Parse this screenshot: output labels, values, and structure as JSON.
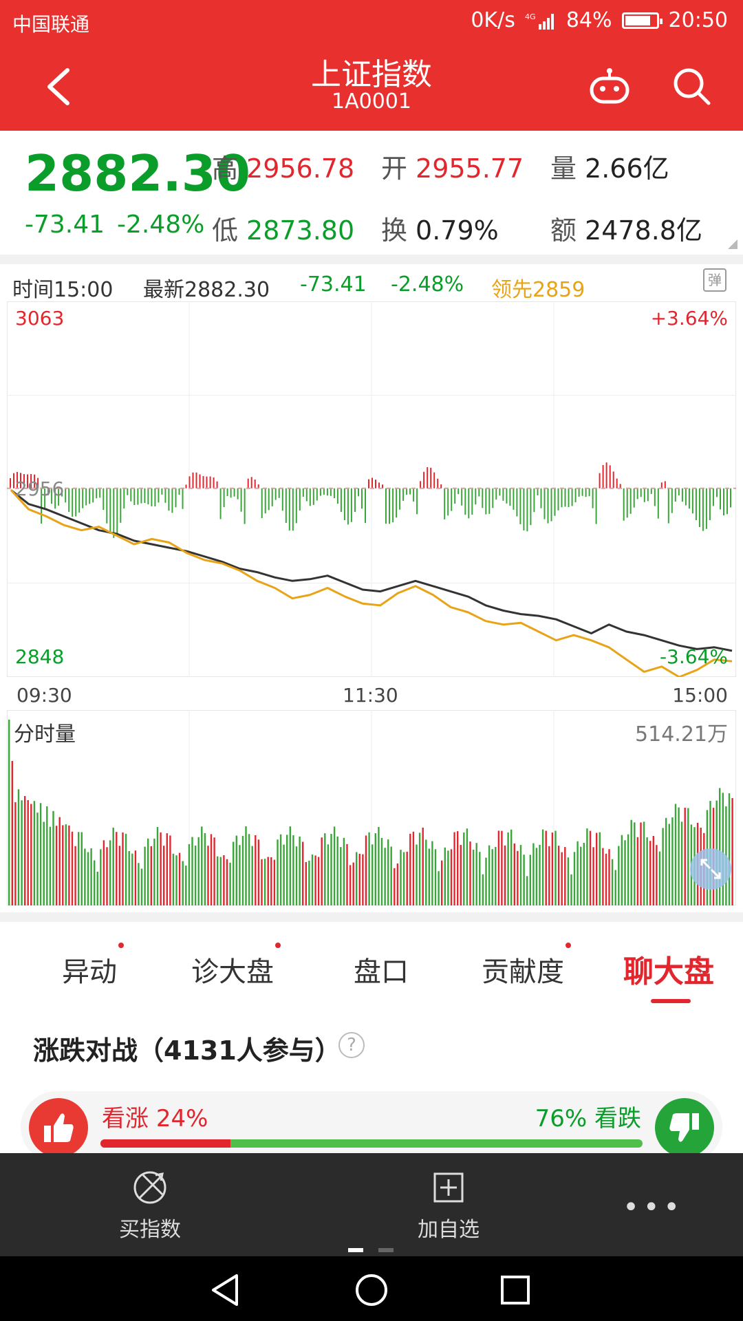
{
  "status": {
    "carrier": "中国联通",
    "speed": "0K/s",
    "battery": "84%",
    "battery_level": 0.84,
    "time": "20:50"
  },
  "header": {
    "title": "上证指数",
    "code": "1A0001"
  },
  "quote": {
    "price": "2882.30",
    "change": "-73.41",
    "change_pct": "-2.48%",
    "high_label": "高",
    "high": "2956.78",
    "open_label": "开",
    "open": "2955.77",
    "volume_label": "量",
    "volume": "2.66亿",
    "low_label": "低",
    "low": "2873.80",
    "turnover_label": "换",
    "turnover": "0.79%",
    "amount_label": "额",
    "amount": "2478.8亿"
  },
  "info": {
    "time": "时间15:00",
    "latest": "最新2882.30",
    "change": "-73.41",
    "pct": "-2.48%",
    "lead": "领先2859",
    "barrage_icon": "弹"
  },
  "chart_data": {
    "type": "line",
    "y_max_label": "3063",
    "y_min_label": "2848",
    "y_mid_label": "2956",
    "pct_max_label": "+3.64%",
    "pct_min_label": "-3.64%",
    "ylim": [
      2848,
      3063
    ],
    "prev_close": 2956,
    "times": [
      "09:30",
      "11:30",
      "15:00"
    ],
    "series": [
      {
        "color": "#333333",
        "values": [
          2955,
          2947,
          2944,
          2940,
          2936,
          2932,
          2930,
          2926,
          2924,
          2922,
          2920,
          2917,
          2914,
          2910,
          2908,
          2905,
          2903,
          2904,
          2906,
          2902,
          2898,
          2897,
          2900,
          2903,
          2900,
          2897,
          2894,
          2889,
          2886,
          2884,
          2883,
          2881,
          2877,
          2873,
          2878,
          2874,
          2872,
          2869,
          2866,
          2864,
          2865,
          2863
        ]
      },
      {
        "color": "#e8a317",
        "values": [
          2955,
          2944,
          2940,
          2935,
          2932,
          2934,
          2929,
          2924,
          2927,
          2925,
          2919,
          2915,
          2913,
          2909,
          2903,
          2899,
          2893,
          2895,
          2899,
          2894,
          2890,
          2889,
          2896,
          2900,
          2895,
          2888,
          2885,
          2880,
          2878,
          2879,
          2874,
          2869,
          2872,
          2869,
          2865,
          2858,
          2851,
          2854,
          2848,
          2852,
          2858,
          2857
        ]
      }
    ],
    "volume_label": "分时量",
    "volume_max_label": "514.21万"
  },
  "tabs": [
    {
      "label": "异动",
      "dot": true
    },
    {
      "label": "诊大盘",
      "dot": true
    },
    {
      "label": "盘口",
      "dot": false
    },
    {
      "label": "贡献度",
      "dot": true
    },
    {
      "label": "聊大盘",
      "dot": false,
      "active": true
    }
  ],
  "battle": {
    "title": "涨跌对战（4131人参与）",
    "help": "?",
    "up_label": "看涨",
    "up_pct": "24%",
    "up_fraction": 0.24,
    "down_label": "看跌",
    "down_pct": "76%"
  },
  "bottom": {
    "buy_index": "买指数",
    "add_watch": "加自选",
    "more": "•••"
  }
}
